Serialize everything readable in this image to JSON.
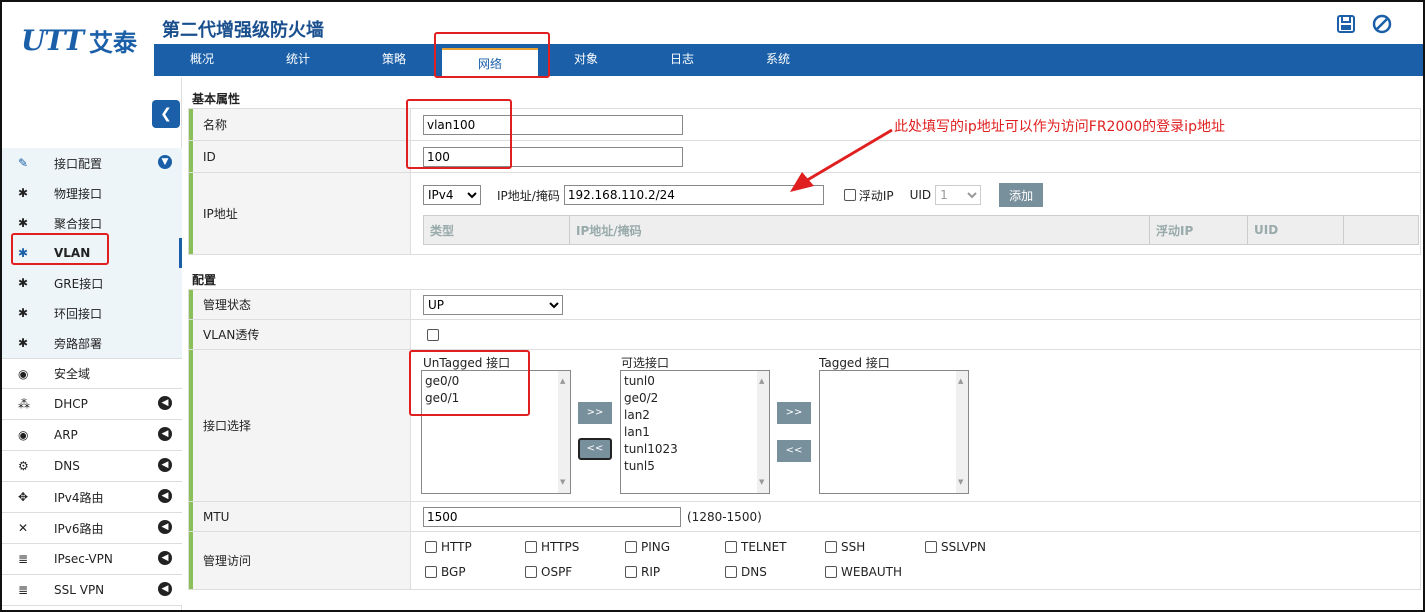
{
  "header": {
    "logo_text": "UTT",
    "logo_cn": "艾泰",
    "title": "第二代增强级防火墙",
    "icons": [
      "save-icon",
      "cancel-icon"
    ]
  },
  "nav": {
    "tabs": [
      "概况",
      "统计",
      "策略",
      "网络",
      "对象",
      "日志",
      "系统"
    ],
    "active": "网络"
  },
  "sidebar": {
    "collapse_icon": "chevron-left-icon",
    "group": {
      "label": "接口配置",
      "items": [
        "物理接口",
        "聚合接口",
        "VLAN",
        "GRE接口",
        "环回接口",
        "旁路部署"
      ],
      "active": "VLAN"
    },
    "items": [
      {
        "label": "安全域",
        "icon": "globe-icon"
      },
      {
        "label": "DHCP",
        "icon": "network-icon"
      },
      {
        "label": "ARP",
        "icon": "globe-icon"
      },
      {
        "label": "DNS",
        "icon": "gears-icon"
      },
      {
        "label": "IPv4路由",
        "icon": "arrows-icon"
      },
      {
        "label": "IPv6路由",
        "icon": "cross-arrows-icon"
      },
      {
        "label": "IPsec-VPN",
        "icon": "list-icon"
      },
      {
        "label": "SSL VPN",
        "icon": "list-icon"
      }
    ]
  },
  "basic": {
    "section_title": "基本属性",
    "name_label": "名称",
    "name_value": "vlan100",
    "id_label": "ID",
    "id_value": "100",
    "ip_label": "IP地址",
    "ip_version": "IPv4",
    "ip_mask_label": "IP地址/掩码",
    "ip_mask_value": "192.168.110.2/24",
    "floating_ip_label": "浮动IP",
    "uid_label": "UID",
    "uid_value": "1",
    "add_button": "添加",
    "table_headers": [
      "类型",
      "IP地址/掩码",
      "浮动IP",
      "UID"
    ]
  },
  "config": {
    "section_title": "配置",
    "admin_state_label": "管理状态",
    "admin_state_value": "UP",
    "vlan_passthrough_label": "VLAN透传",
    "interface_select_label": "接口选择",
    "untagged_title": "UnTagged 接口",
    "untagged_items": [
      "ge0/0",
      "ge0/1"
    ],
    "available_title": "可选接口",
    "available_items": [
      "tunl0",
      "ge0/2",
      "lan2",
      "lan1",
      "tunl1023",
      "tunl5"
    ],
    "tagged_title": "Tagged 接口",
    "tagged_items": [],
    "move_right": ">>",
    "move_left": "<<",
    "mtu_label": "MTU",
    "mtu_value": "1500",
    "mtu_range": "(1280-1500)",
    "mgmt_access_label": "管理访问",
    "services_row1": [
      "HTTP",
      "HTTPS",
      "PING",
      "TELNET",
      "SSH",
      "SSLVPN"
    ],
    "services_row2": [
      "BGP",
      "OSPF",
      "RIP",
      "DNS",
      "WEBAUTH"
    ]
  },
  "annotation": {
    "text": "此处填写的ip地址可以作为访问FR2000的登录ip地址"
  }
}
